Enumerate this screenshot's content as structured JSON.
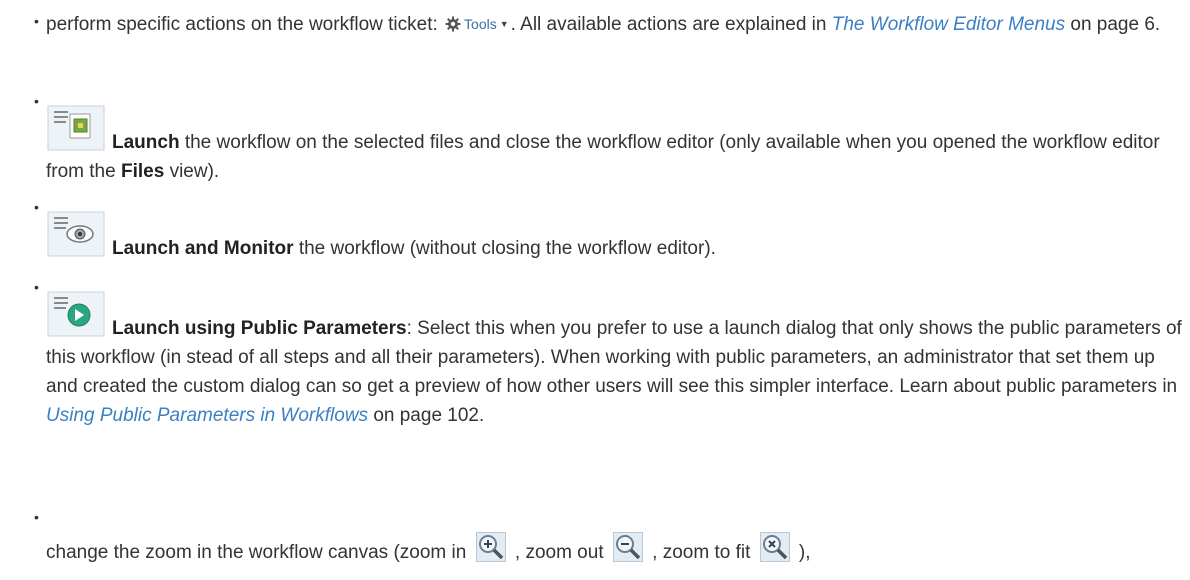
{
  "items": [
    {
      "pre": "perform specific actions on the workflow ticket: ",
      "tools_label": "Tools",
      "mid": ". All available actions are explained in ",
      "link": "The Workflow Editor Menus",
      "post": " on page 6."
    },
    {
      "icon": "launch-icon",
      "bold": "Launch",
      "text1": " the workflow on the selected files and close the workflow editor (only available when you opened the workflow editor from the ",
      "bold2": "Files",
      "text2": " view)."
    },
    {
      "icon": "launch-and-monitor-icon",
      "bold": "Launch and Monitor",
      "text1": " the workflow (without closing the workflow editor)."
    },
    {
      "icon": "launch-public-parameters-icon",
      "bold": "Launch using Public Parameters",
      "text1": ": Select this when you prefer to use a launch dialog that only shows the public parameters of this workflow (in stead of all steps and all their parameters). When working with public parameters, an administrator that set them up and created the custom dialog can so get a preview of how other users will see this simpler interface. Learn about public parameters in ",
      "link": "Using Public Parameters in Workflows",
      "post": " on page 102."
    },
    {
      "t1": "change the zoom in the workflow canvas (zoom in ",
      "t2": " , zoom out ",
      "t3": " , zoom to fit ",
      "t4": " ),"
    }
  ],
  "colors": {
    "link": "#3b7fc4",
    "text": "#333333"
  }
}
